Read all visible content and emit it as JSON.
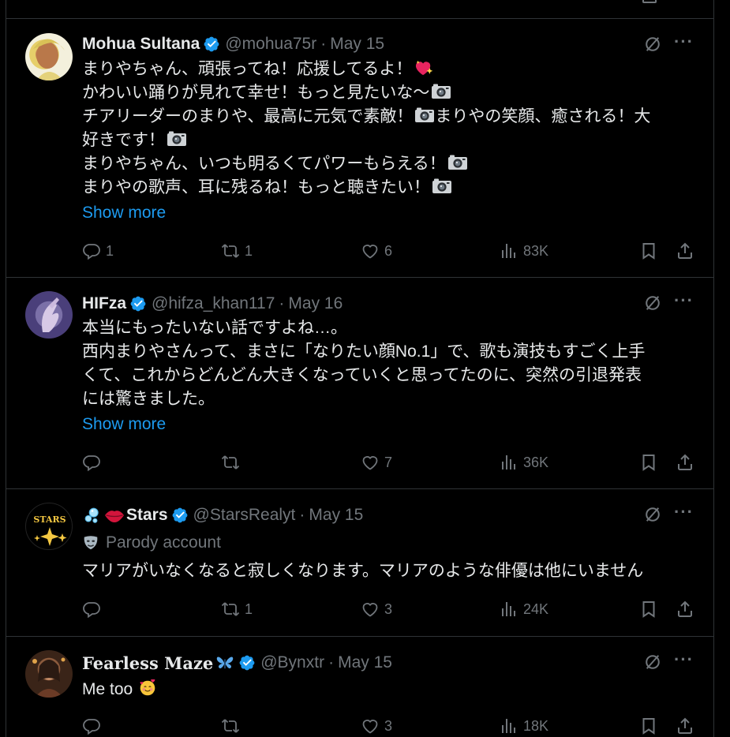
{
  "colors": {
    "background": "#000000",
    "text": "#e7e9ea",
    "muted": "#71767b",
    "link": "#1d9bf0",
    "verified": "#1d9bf0",
    "border": "#2f3336"
  },
  "tweets": [
    {
      "name": "Mohua Sultana",
      "handle": "@mohua75r",
      "dot": "·",
      "date": "May 15",
      "lines": [
        "まりやちゃん、頑張ってね！応援してるよ！",
        "かわいい踊りが見れて幸せ！もっと見たいな〜",
        "チアリーダーのまりや、最高に元気で素敵！",
        "まりやの笑顔、癒される！大",
        "好きです！",
        "まりやちゃん、いつも明るくてパワーもらえる！",
        "まりやの歌声、耳に残るね！もっと聴きたい！"
      ],
      "show_more": "Show more",
      "replies": "1",
      "reposts": "1",
      "likes": "6",
      "views": "83K"
    },
    {
      "name": "HIFza",
      "handle": "@hifza_khan117",
      "dot": "·",
      "date": "May 16",
      "lines": [
        "本当にもったいない話ですよね…。",
        "西内まりやさんって、まさに「なりたい顔No.1」で、歌も演技もすごく上手",
        "くて、これからどんどん大きくなっていくと思ってたのに、突然の引退発表",
        "には驚きました。"
      ],
      "show_more": "Show more",
      "replies": "",
      "reposts": "",
      "likes": "7",
      "views": "36K"
    },
    {
      "name": "Stars",
      "handle": "@StarsRealyt",
      "dot": "·",
      "date": "May 15",
      "parody": "Parody account",
      "avatar_text": "STARS",
      "lines": [
        "マリアがいなくなると寂しくなります。マリアのような俳優は他にいません"
      ],
      "replies": "",
      "reposts": "1",
      "likes": "3",
      "views": "24K"
    },
    {
      "name": "Fearless Maze",
      "handle": "@Bynxtr",
      "dot": "·",
      "date": "May 15",
      "lines": [
        "Me too"
      ],
      "replies": "",
      "reposts": "",
      "likes": "3",
      "views": "18K"
    }
  ]
}
